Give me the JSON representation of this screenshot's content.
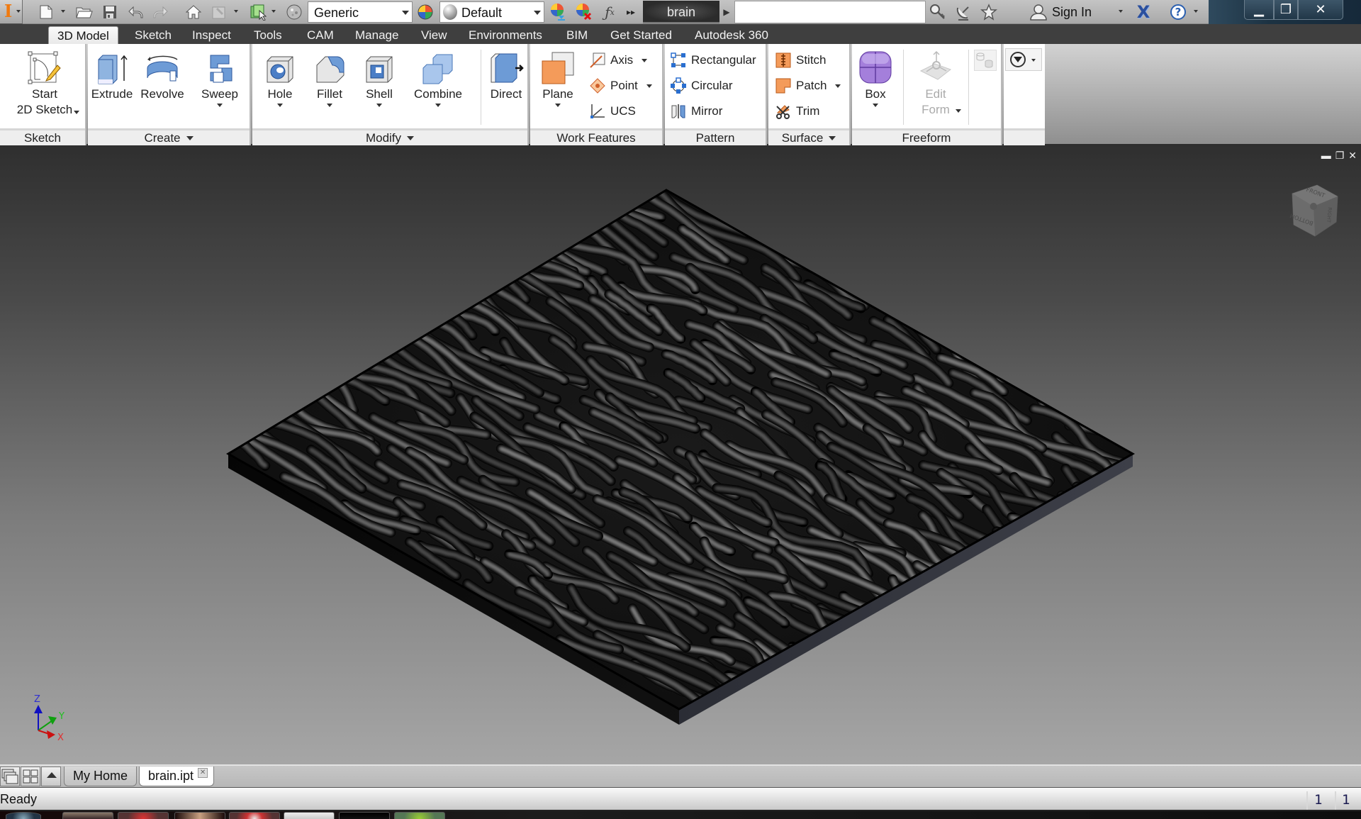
{
  "title_bar": {
    "app_menu_icon": "inventor-logo-icon",
    "quick_access": [
      {
        "name": "new-icon",
        "has_dropdown": true
      },
      {
        "name": "open-icon"
      },
      {
        "name": "save-icon"
      },
      {
        "name": "undo-icon"
      },
      {
        "name": "redo-icon"
      },
      {
        "name": "home-icon"
      },
      {
        "name": "update-icon",
        "has_dropdown": true
      },
      {
        "name": "select-icon",
        "has_dropdown": true
      },
      {
        "name": "material-sphere-icon"
      }
    ],
    "material_combo": "Generic",
    "appearance_combo": "Default",
    "after_combo_icons": [
      "adjust-appearance-icon",
      "clear-appearance-icon",
      "parameters-fx-icon",
      "more-icon"
    ],
    "document_name": "brain",
    "search_value": "",
    "right_icons": [
      "key-icon",
      "satellite-icon",
      "favorites-star-icon"
    ],
    "sign_in_label": "Sign In",
    "exchange_icon": "autodesk-exchange-icon",
    "help_icon": "help-icon",
    "window_controls": {
      "minimize": "minimize-icon",
      "restore": "restore-icon",
      "close": "close-icon"
    }
  },
  "ribbon_tabs": [
    {
      "label": "3D Model",
      "active": true
    },
    {
      "label": "Sketch"
    },
    {
      "label": "Inspect"
    },
    {
      "label": "Tools"
    },
    {
      "label": "CAM"
    },
    {
      "label": "Manage"
    },
    {
      "label": "View"
    },
    {
      "label": "Environments"
    },
    {
      "label": "BIM"
    },
    {
      "label": "Get Started"
    },
    {
      "label": "Autodesk 360"
    }
  ],
  "ribbon": {
    "sketch": {
      "title": "Sketch",
      "start_line1": "Start",
      "start_line2": "2D Sketch"
    },
    "create": {
      "title": "Create",
      "extrude": "Extrude",
      "revolve": "Revolve",
      "sweep": "Sweep"
    },
    "modify": {
      "title": "Modify",
      "hole": "Hole",
      "fillet": "Fillet",
      "shell": "Shell",
      "combine": "Combine",
      "direct": "Direct"
    },
    "work_features": {
      "title": "Work Features",
      "plane": "Plane",
      "axis": "Axis",
      "point": "Point",
      "ucs": "UCS"
    },
    "pattern": {
      "title": "Pattern",
      "rectangular": "Rectangular",
      "circular": "Circular",
      "mirror": "Mirror"
    },
    "surface": {
      "title": "Surface",
      "stitch": "Stitch",
      "patch": "Patch",
      "trim": "Trim"
    },
    "freeform": {
      "title": "Freeform",
      "box": "Box",
      "edit_line1": "Edit",
      "edit_line2": "Form"
    }
  },
  "viewport": {
    "model_name": "brain.ipt",
    "viewcube_faces": {
      "top": "FRONT",
      "left": "BOTTOM",
      "right": "RIGHT"
    },
    "triad": {
      "x": "X",
      "y": "Y",
      "z": "Z"
    },
    "colors": {
      "x": "#cc1010",
      "y": "#10a010",
      "z": "#1010c0"
    }
  },
  "doc_tabs": [
    {
      "label": "My Home",
      "active": false
    },
    {
      "label": "brain.ipt",
      "active": true,
      "closable": true
    }
  ],
  "status_bar": {
    "text": "Ready",
    "count1": "1",
    "count2": "1"
  }
}
